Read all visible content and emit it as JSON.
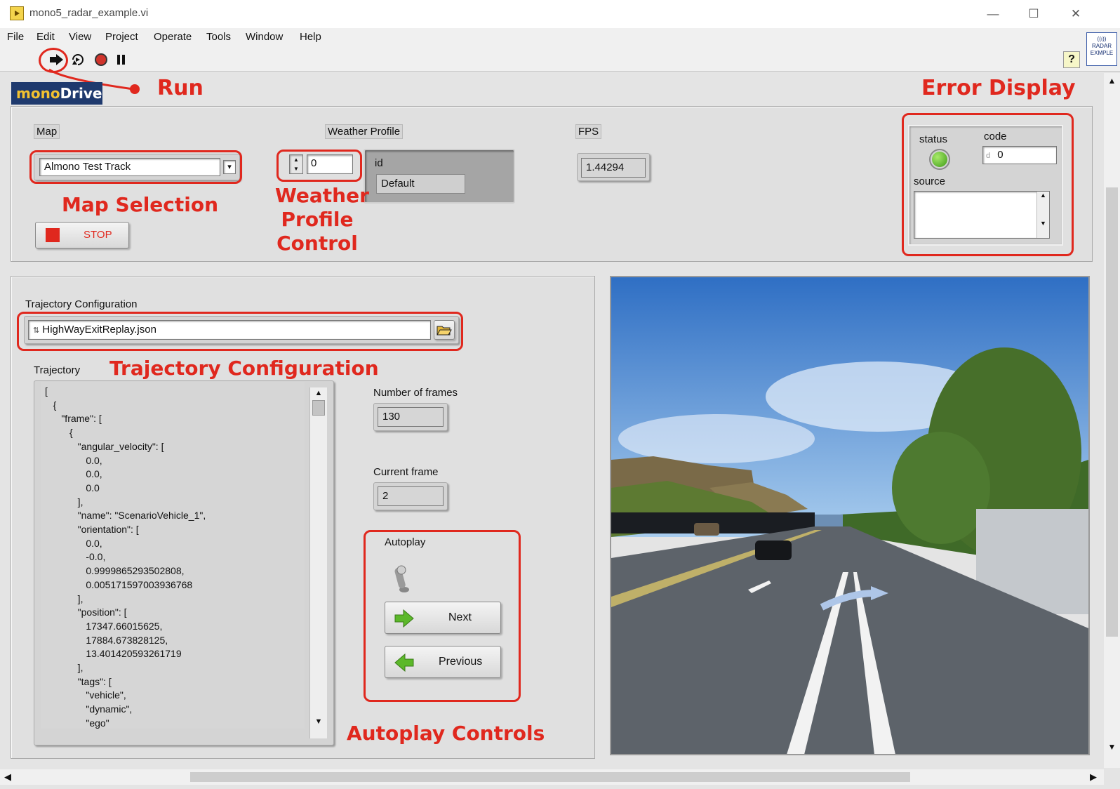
{
  "window": {
    "title": "mono5_radar_example.vi",
    "minimize": "—",
    "maximize": "☐",
    "close": "✕"
  },
  "menu": [
    "File",
    "Edit",
    "View",
    "Project",
    "Operate",
    "Tools",
    "Window",
    "Help"
  ],
  "toolbar": {
    "radar_badge_l1": "((ı))",
    "radar_badge_l2": "RADAR",
    "radar_badge_l3": "EXMPLE",
    "help": "?"
  },
  "logo": {
    "mono": "mono",
    "drive": "Drive"
  },
  "annotations": {
    "run": "Run",
    "error_display": "Error Display",
    "map_selection": "Map Selection",
    "weather_l1": "Weather",
    "weather_l2": "Profile",
    "weather_l3": "Control",
    "trajectory_configuration": "Trajectory Configuration",
    "autoplay_controls": "Autoplay Controls"
  },
  "map": {
    "label": "Map",
    "value": "Almono Test Track"
  },
  "weather": {
    "label": "Weather Profile",
    "index": "0",
    "id_label": "id",
    "id_value": "Default"
  },
  "fps": {
    "label": "FPS",
    "value": "1.44294"
  },
  "stop": {
    "label": "STOP"
  },
  "error": {
    "status_label": "status",
    "code_label": "code",
    "code_prefix": "d",
    "code_value": "0",
    "source_label": "source",
    "status_color": "#5cb82a"
  },
  "trajectory_config": {
    "label": "Trajectory Configuration",
    "value": "HighWayExitReplay.json"
  },
  "trajectory": {
    "label": "Trajectory",
    "text": "[\n   {\n      \"frame\": [\n         {\n            \"angular_velocity\": [\n               0.0,\n               0.0,\n               0.0\n            ],\n            \"name\": \"ScenarioVehicle_1\",\n            \"orientation\": [\n               0.0,\n               -0.0,\n               0.9999865293502808,\n               0.005171597003936768\n            ],\n            \"position\": [\n               17347.66015625,\n               17884.673828125,\n               13.401420593261719\n            ],\n            \"tags\": [\n               \"vehicle\",\n               \"dynamic\",\n               \"ego\""
  },
  "frames": {
    "total_label": "Number of frames",
    "total": "130",
    "current_label": "Current frame",
    "current": "2"
  },
  "autoplay": {
    "label": "Autoplay",
    "next": "Next",
    "previous": "Previous"
  },
  "colors": {
    "annotation": "#e0281e",
    "logo_bg": "#1f3a6e",
    "logo_accent": "#f2c230"
  }
}
